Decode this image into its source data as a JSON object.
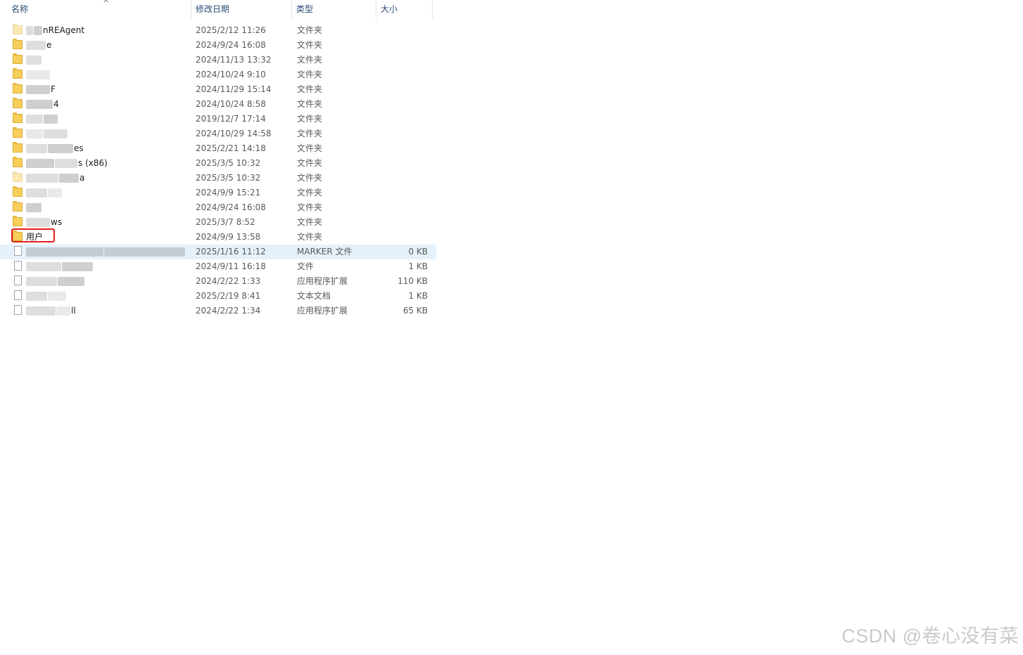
{
  "columns": {
    "name": "名称",
    "date": "修改日期",
    "type": "类型",
    "size": "大小"
  },
  "sort_indicator": "^",
  "rows": [
    {
      "name": "nREAgent",
      "date": "2025/2/12 11:26",
      "type": "文件夹",
      "size": "",
      "icon": "folder-icon"
    },
    {
      "name": "e",
      "date": "2024/9/24 16:08",
      "type": "文件夹",
      "size": "",
      "icon": "folder-icon"
    },
    {
      "name": "",
      "date": "2024/11/13 13:32",
      "type": "文件夹",
      "size": "",
      "icon": "folder-icon"
    },
    {
      "name": "",
      "date": "2024/10/24 9:10",
      "type": "文件夹",
      "size": "",
      "icon": "folder-icon"
    },
    {
      "name": "F",
      "date": "2024/11/29 15:14",
      "type": "文件夹",
      "size": "",
      "icon": "folder-icon"
    },
    {
      "name": "4",
      "date": "2024/10/24 8:58",
      "type": "文件夹",
      "size": "",
      "icon": "folder-icon"
    },
    {
      "name": "",
      "date": "2019/12/7 17:14",
      "type": "文件夹",
      "size": "",
      "icon": "folder-icon"
    },
    {
      "name": "",
      "date": "2024/10/29 14:58",
      "type": "文件夹",
      "size": "",
      "icon": "folder-icon"
    },
    {
      "name": "es",
      "date": "2025/2/21 14:18",
      "type": "文件夹",
      "size": "",
      "icon": "folder-icon"
    },
    {
      "name": "s (x86)",
      "date": "2025/3/5 10:32",
      "type": "文件夹",
      "size": "",
      "icon": "folder-icon"
    },
    {
      "name": "a",
      "date": "2025/3/5 10:32",
      "type": "文件夹",
      "size": "",
      "icon": "folder-icon"
    },
    {
      "name": "",
      "date": "2024/9/9 15:21",
      "type": "文件夹",
      "size": "",
      "icon": "folder-icon"
    },
    {
      "name": "",
      "date": "2024/9/24 16:08",
      "type": "文件夹",
      "size": "",
      "icon": "folder-icon"
    },
    {
      "name": "ws",
      "date": "2025/3/7 8:52",
      "type": "文件夹",
      "size": "",
      "icon": "folder-icon"
    },
    {
      "name": "用户",
      "date": "2024/9/9 13:58",
      "type": "文件夹",
      "size": "",
      "icon": "folder-icon"
    },
    {
      "name": "",
      "date": "2025/1/16 11:12",
      "type": "MARKER 文件",
      "size": "0 KB",
      "icon": "file-icon"
    },
    {
      "name": "",
      "date": "2024/9/11 16:18",
      "type": "文件",
      "size": "1 KB",
      "icon": "file-icon"
    },
    {
      "name": "",
      "date": "2024/2/22 1:33",
      "type": "应用程序扩展",
      "size": "110 KB",
      "icon": "file-icon"
    },
    {
      "name": "",
      "date": "2025/2/19 8:41",
      "type": "文本文档",
      "size": "1 KB",
      "icon": "file-icon"
    },
    {
      "name": "ll",
      "date": "2024/2/22 1:34",
      "type": "应用程序扩展",
      "size": "65 KB",
      "icon": "file-icon"
    }
  ],
  "watermark": "CSDN @卷心没有菜"
}
